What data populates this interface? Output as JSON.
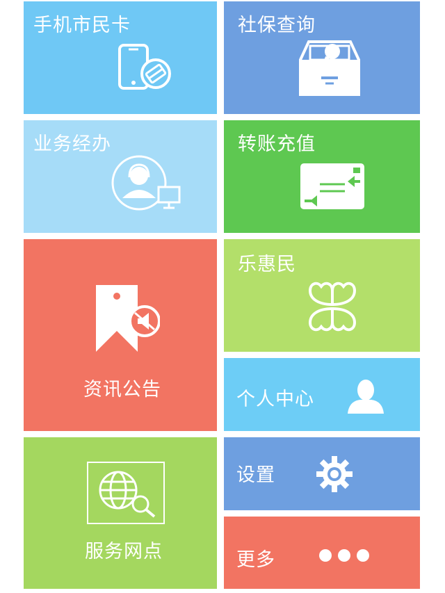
{
  "tiles": {
    "mobile_card": {
      "label": "手机市民卡",
      "color": "#6fc8f5",
      "icon": "phone-card-icon"
    },
    "social_security": {
      "label": "社保查询",
      "color": "#6e9fe0",
      "icon": "search-box-icon"
    },
    "business": {
      "label": "业务经办",
      "color": "#a6dcf8",
      "icon": "customer-service-icon"
    },
    "transfer": {
      "label": "转账充值",
      "color": "#5ec851",
      "icon": "transfer-card-icon"
    },
    "news": {
      "label": "资讯公告",
      "color": "#f27462",
      "icon": "bookmark-announcement-icon"
    },
    "lehuimin": {
      "label": "乐惠民",
      "color": "#b3df6a",
      "icon": "clover-icon"
    },
    "personal": {
      "label": "个人中心",
      "color": "#6dcdf6",
      "icon": "user-icon"
    },
    "service_points": {
      "label": "服务网点",
      "color": "#a4d75f",
      "icon": "globe-search-icon"
    },
    "settings": {
      "label": "设置",
      "color": "#6e9fe0",
      "icon": "gear-icon"
    },
    "more": {
      "label": "更多",
      "color": "#f27462",
      "icon": "more-dots-icon"
    }
  }
}
